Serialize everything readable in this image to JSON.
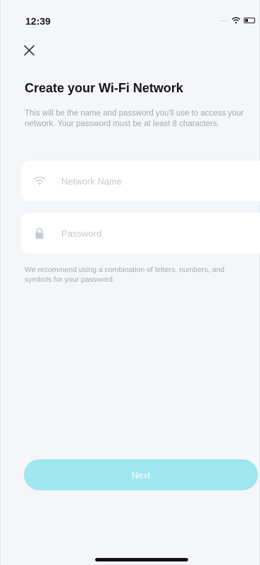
{
  "status_bar": {
    "time": "12:39",
    "signal_icon": "signal-dots",
    "wifi_icon": "wifi-icon",
    "battery_icon": "battery-icon"
  },
  "header": {
    "close_icon": "close-icon"
  },
  "main": {
    "title": "Create your Wi-Fi Network",
    "description": "This will be the name and password you'll use to access your network. Your password must be at least 8 characters.",
    "fields": {
      "network_name": {
        "icon": "wifi-icon",
        "placeholder": "Network Name",
        "value": ""
      },
      "password": {
        "icon": "lock-icon",
        "placeholder": "Password",
        "value": ""
      }
    },
    "hint": "We recommend using a combination of letters, numbers, and symbols for your password.",
    "next_label": "Next"
  },
  "colors": {
    "background": "#f4f6f9",
    "field_background": "#ffffff",
    "button_disabled": "#9fe6f0",
    "muted_text": "#a4a9b0"
  }
}
